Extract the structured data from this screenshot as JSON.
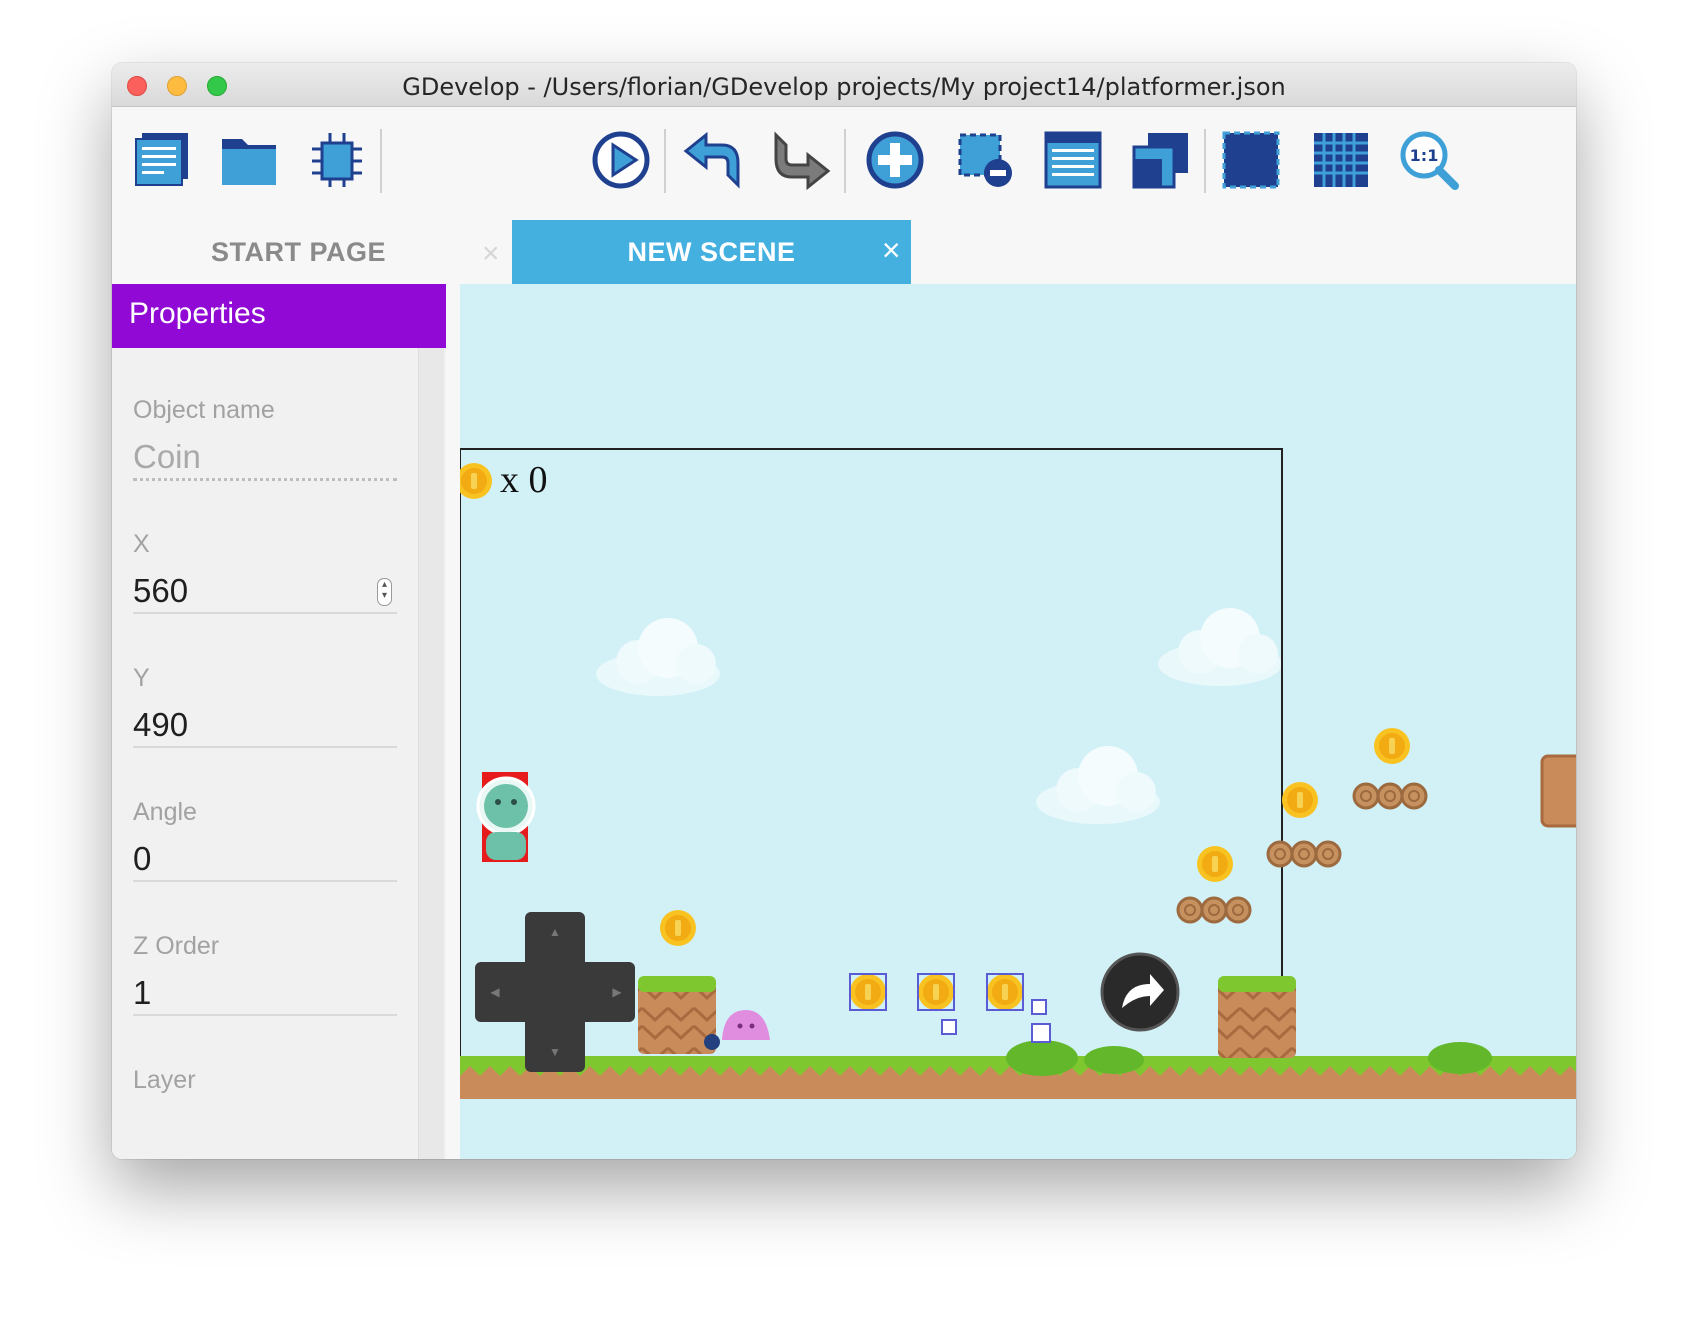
{
  "window": {
    "title": "GDevelop - /Users/florian/GDevelop projects/My project14/platformer.json"
  },
  "toolbar": {
    "icons": [
      "project-manager-icon",
      "open-icon",
      "events-icon",
      "preview-icon",
      "undo-icon",
      "redo-icon",
      "add-object-icon",
      "delete-selection-icon",
      "object-list-icon",
      "layers-icon",
      "window-mask-icon",
      "grid-icon",
      "zoom-reset-icon"
    ]
  },
  "tabs": {
    "start_page": "START PAGE",
    "new_scene": "NEW SCENE",
    "close_symbol": "×"
  },
  "properties": {
    "title": "Properties",
    "object_name_label": "Object name",
    "object_name_value": "Coin",
    "x_label": "X",
    "x_value": "560",
    "y_label": "Y",
    "y_value": "490",
    "angle_label": "Angle",
    "angle_value": "0",
    "z_order_label": "Z Order",
    "z_order_value": "1",
    "layer_label": "Layer"
  },
  "scene": {
    "coin_counter": "x 0",
    "sky_color": "#d2f1f7",
    "ground_color": "#7fc72f"
  }
}
